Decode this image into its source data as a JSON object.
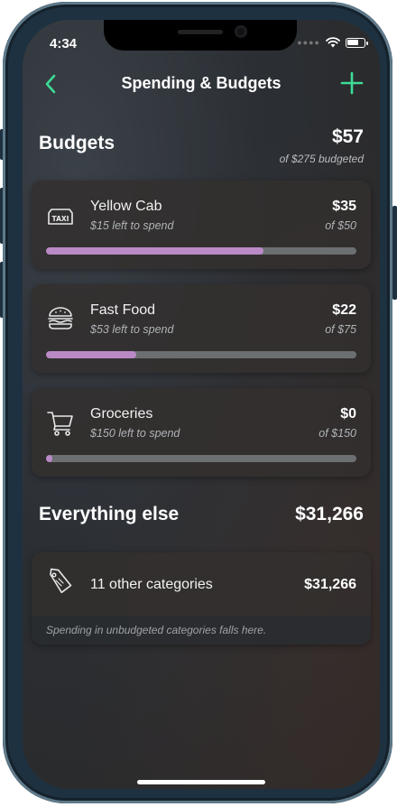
{
  "status_bar": {
    "time": "4:34",
    "signal_dots": "●●●●"
  },
  "nav": {
    "title": "Spending & Budgets",
    "accent_color": "#3ddc97"
  },
  "budgets": {
    "title": "Budgets",
    "total": "$57",
    "subtitle": "of $275 budgeted",
    "items": [
      {
        "icon": "taxi-icon",
        "name": "Yellow Cab",
        "left": "$15 left to spend",
        "amount": "$35",
        "of": "of $50",
        "progress": 0.7
      },
      {
        "icon": "burger-icon",
        "name": "Fast Food",
        "left": "$53 left to spend",
        "amount": "$22",
        "of": "of $75",
        "progress": 0.29
      },
      {
        "icon": "cart-icon",
        "name": "Groceries",
        "left": "$150 left to spend",
        "amount": "$0",
        "of": "of $150",
        "progress": 0.02
      }
    ],
    "progress_color": "#b98ac6"
  },
  "everything_else": {
    "title": "Everything else",
    "total": "$31,266",
    "card_name": "11 other categories",
    "card_amount": "$31,266",
    "footer": "Spending in unbudgeted categories falls here."
  }
}
